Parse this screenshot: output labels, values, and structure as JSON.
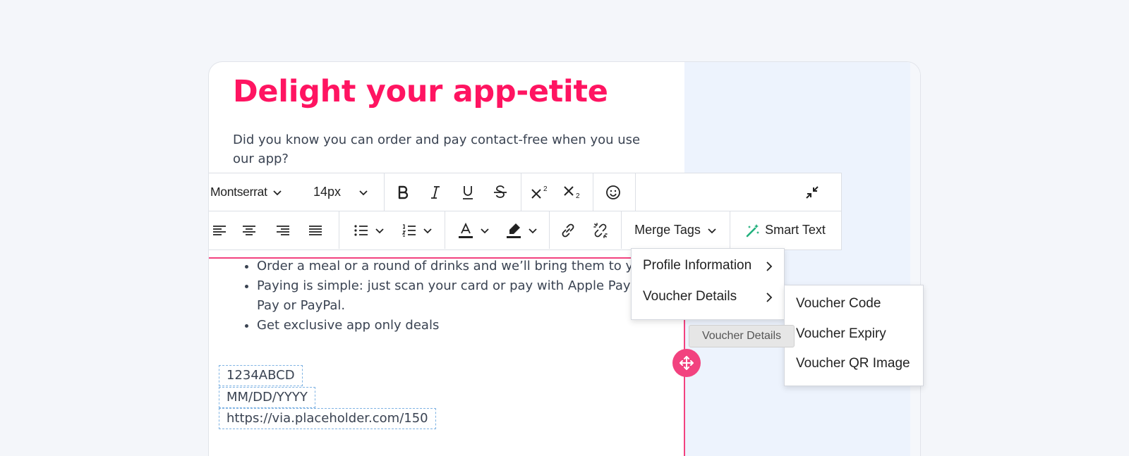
{
  "content": {
    "heading": "Delight your app-etite",
    "intro": "Did you know you can order and pay contact-free when you use our app?",
    "bullets": [
      "Order a meal or a round of drinks and we’ll bring them to your table",
      "Paying is simple: just scan your card or pay with Apple Pay, Google Pay or PayPal.",
      "Get exclusive app only deals"
    ],
    "merge_tag_values": [
      "1234ABCD",
      "MM/DD/YYYY",
      "https://via.placeholder.com/150"
    ]
  },
  "toolbar": {
    "font_family": "Montserrat",
    "font_size": "14px",
    "merge_tags_label": "Merge Tags",
    "smart_text_label": "Smart Text",
    "icons": [
      "bold-icon",
      "italic-icon",
      "underline-icon",
      "strikethrough-icon",
      "superscript-icon",
      "subscript-icon",
      "emoji-icon",
      "collapse-icon",
      "align-left-icon",
      "align-center-icon",
      "align-right-icon",
      "align-justify-icon",
      "bullet-list-icon",
      "numbered-list-icon",
      "text-color-icon",
      "highlight-icon",
      "link-icon",
      "unlink-icon",
      "magic-wand-icon"
    ]
  },
  "merge_menu": {
    "items": [
      "Profile Information",
      "Voucher Details"
    ]
  },
  "voucher_submenu": {
    "items": [
      "Voucher Code",
      "Voucher Expiry",
      "Voucher QR Image"
    ]
  },
  "tooltip": "Voucher Details",
  "colors": {
    "heading": "#ff1461",
    "guide": "#f2427f",
    "smart_text_icon": "#22b07d",
    "side_panel": "#edf3fd"
  }
}
